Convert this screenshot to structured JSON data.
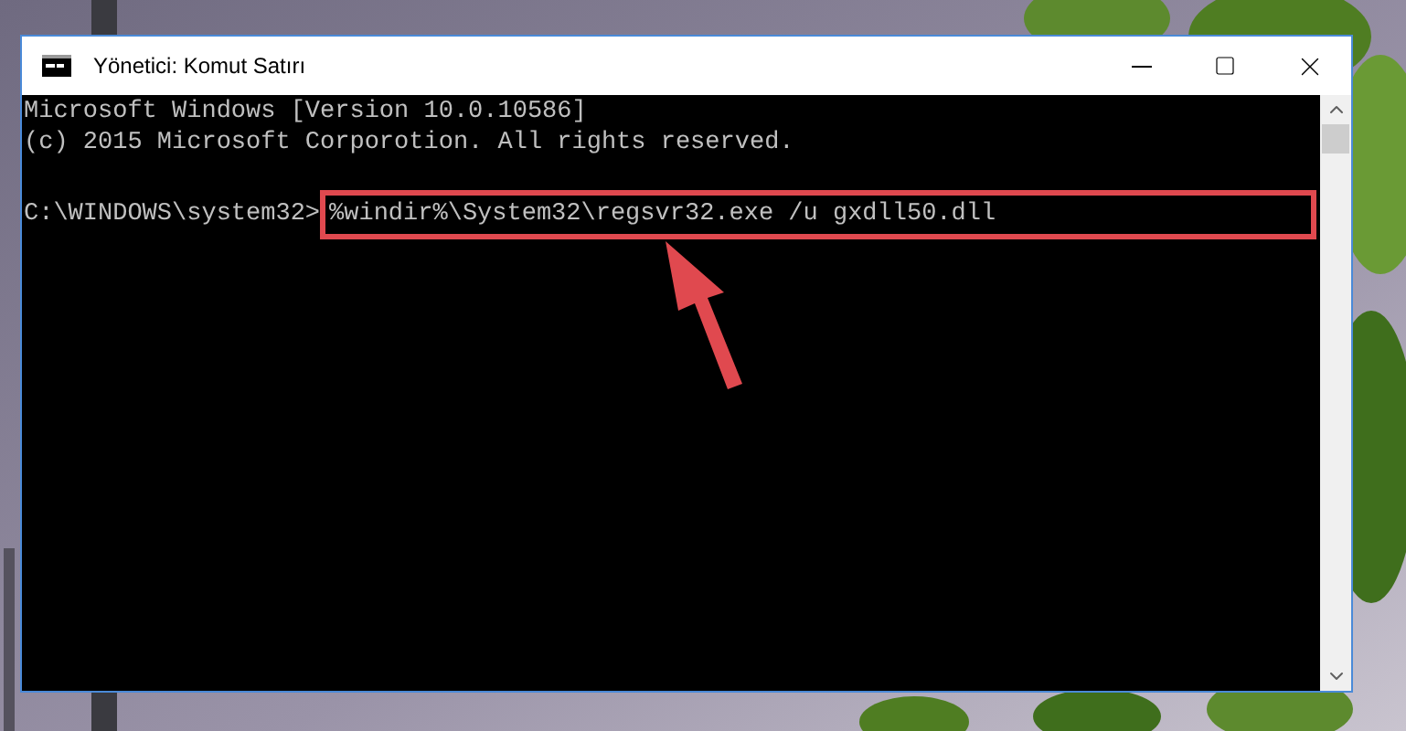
{
  "window": {
    "title": "Yönetici: Komut Satırı"
  },
  "console": {
    "lines": [
      "Microsoft Windows [Version 10.0.10586]",
      "(c) 2015 Microsoft Corporotion. All rights reserved."
    ],
    "prompt": "C:\\WINDOWS\\system32>",
    "command": "%windir%\\System32\\regsvr32.exe /u gxdll50.dll",
    "command_highlighted": true
  }
}
